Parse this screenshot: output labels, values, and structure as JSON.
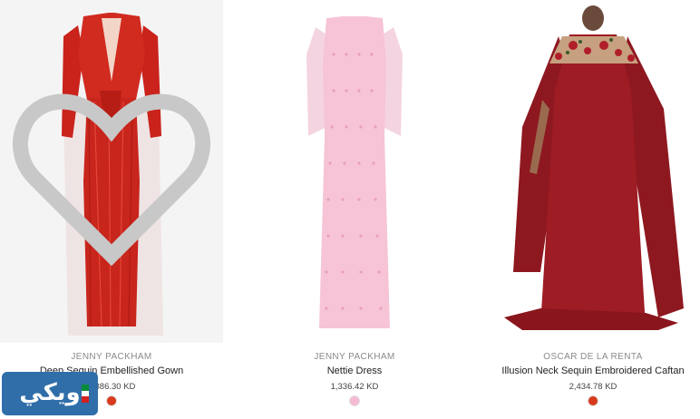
{
  "products": [
    {
      "brand": "JENNY PACKHAM",
      "name": "Deep Sequin Embellished Gown",
      "price": "1,386.30 KD",
      "swatch_color": "#d9391c",
      "icon": "heart-icon"
    },
    {
      "brand": "JENNY PACKHAM",
      "name": "Nettie Dress",
      "price": "1,336.42 KD",
      "swatch_color": "#f6b9d3"
    },
    {
      "brand": "OSCAR DE LA RENTA",
      "name": "Illusion Neck Sequin Embroidered Caftan",
      "price": "2,434.78 KD",
      "swatch_color": "#d9391c"
    }
  ],
  "watermark": {
    "text": "ويكي",
    "color": "#2f6ea8"
  }
}
